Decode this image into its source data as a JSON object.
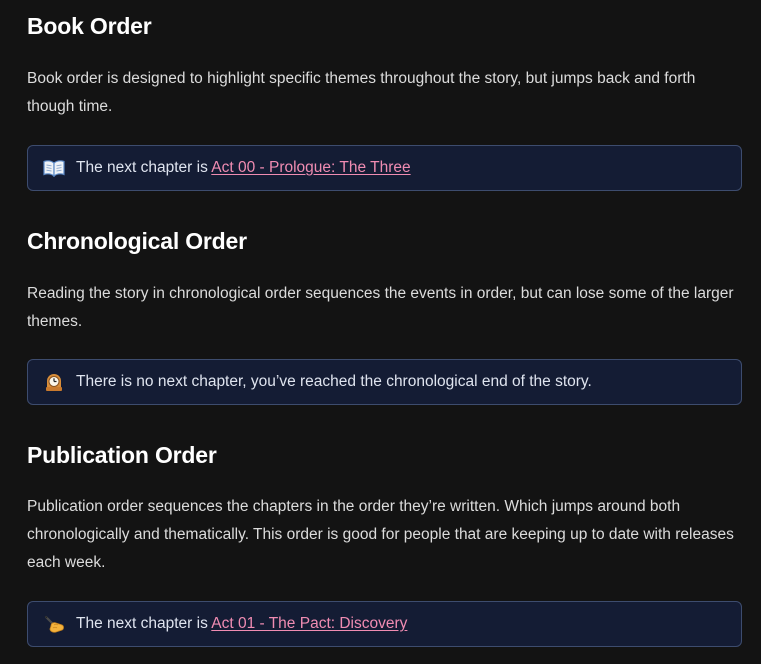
{
  "sections": [
    {
      "title": "Book Order",
      "description": "Book order is designed to highlight specific themes throughout the story, but jumps back and forth though time.",
      "callout": {
        "icon": "open-book-icon",
        "prefix": "The next chapter is ",
        "link": "Act 00 - Prologue: The Three"
      }
    },
    {
      "title": "Chronological Order",
      "description": "Reading the story in chronological order sequences the events in order, but can lose some of the larger themes.",
      "callout": {
        "icon": "mantelpiece-clock-icon",
        "prefix": "There is no next chapter, you’ve reached the chronological end of the story.",
        "link": ""
      }
    },
    {
      "title": "Publication Order",
      "description": "Publication order sequences the chapters in the order they’re written. Which jumps around both chronologically and thematically. This order is good for people that are keeping up to date with releases each week.",
      "callout": {
        "icon": "writing-hand-icon",
        "prefix": "The next chapter is ",
        "link": "Act 01 - The Pact: Discovery"
      }
    }
  ],
  "colors": {
    "background": "#131313",
    "callout_bg": "#141c34",
    "callout_border": "#3d4c6e",
    "link": "#f08cb2"
  }
}
